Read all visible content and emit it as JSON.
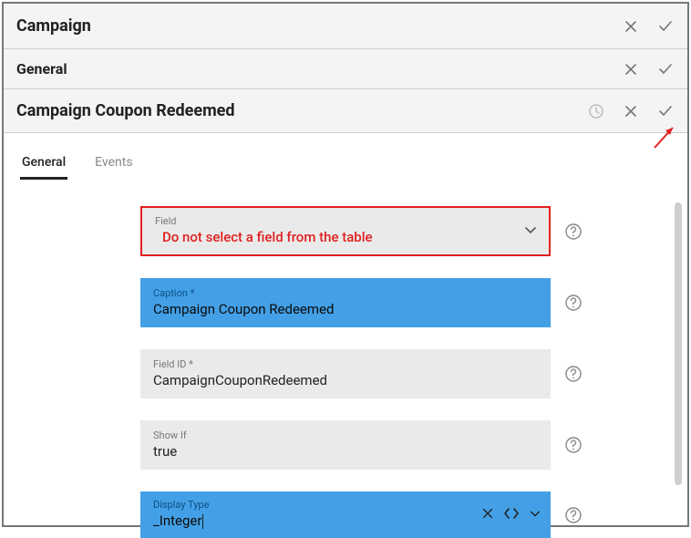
{
  "headers": {
    "campaign": "Campaign",
    "general": "General",
    "page": "Campaign Coupon Redeemed"
  },
  "tabs": {
    "general": "General",
    "events": "Events"
  },
  "form": {
    "field": {
      "label": "Field",
      "value": "Do not select a field from the table"
    },
    "caption": {
      "label": "Caption *",
      "value": "Campaign Coupon Redeemed"
    },
    "field_id": {
      "label": "Field ID *",
      "value": "CampaignCouponRedeemed"
    },
    "show_if": {
      "label": "Show If",
      "value": "true"
    },
    "display_type": {
      "label": "Display Type",
      "value": "_Integer"
    }
  }
}
